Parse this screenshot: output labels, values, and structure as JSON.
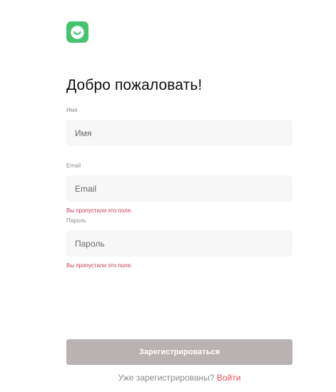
{
  "brand": {
    "logo_icon": "smile-icon",
    "color": "#45c470"
  },
  "page": {
    "title": "Добро пожаловать!"
  },
  "form": {
    "name": {
      "label": "Имя",
      "placeholder": "Имя",
      "value": ""
    },
    "email": {
      "label": "Email",
      "placeholder": "Email",
      "value": "",
      "error": "Вы пропустили это поле."
    },
    "password": {
      "label": "Пароль",
      "placeholder": "Пароль",
      "value": "",
      "error": "Вы пропустили это поле."
    },
    "submit_label": "Зарегистрироваться"
  },
  "footer": {
    "prompt": "Уже зарегистрированы?",
    "login_label": "Войти"
  },
  "colors": {
    "error": "#c23a56",
    "link": "#e0534f",
    "button_disabled": "#b8b2b2",
    "input_background": "#f7f7f7"
  }
}
